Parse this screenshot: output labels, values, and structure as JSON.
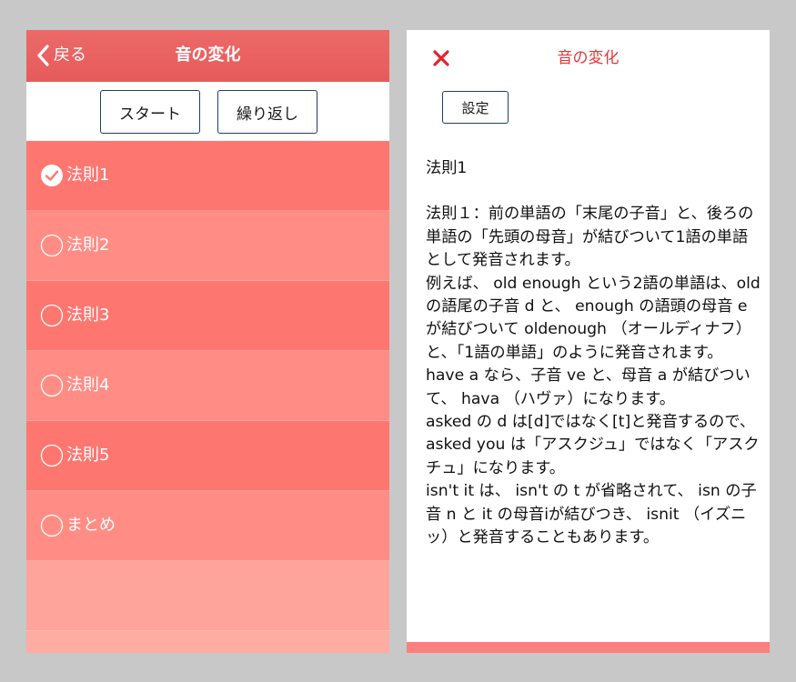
{
  "left": {
    "nav": {
      "back_label": "戻る",
      "title": "音の変化"
    },
    "toolbar": {
      "start_label": "スタート",
      "repeat_label": "繰り返し"
    },
    "items": [
      {
        "label": "法則1",
        "checked": true
      },
      {
        "label": "法則2",
        "checked": false
      },
      {
        "label": "法則3",
        "checked": false
      },
      {
        "label": "法則4",
        "checked": false
      },
      {
        "label": "法則5",
        "checked": false
      },
      {
        "label": "まとめ",
        "checked": false
      }
    ]
  },
  "right": {
    "title": "音の変化",
    "settings_label": "設定",
    "heading": "法則1",
    "body": "法則１：前の単語の「末尾の子音」と、後ろの単語の「先頭の母音」が結びついて1語の単語として発音されます。\n例えば、 old enough という2語の単語は、old の語尾の子音 d と、 enough の語頭の母音 e が結びついて oldenough （オールディナフ）と、「1語の単語」のように発音されます。\nhave a なら、子音 ve と、母音 a が結びついて、 hava （ハヴァ）になります。\nasked の d は[d]ではなく[t]と発音するので、 asked you は「アスクジュ」ではなく「アスクチュ」になります。\nisn't it は、 isn't の t が省略されて、 isn の子音 n と it の母音iが結びつき、 isnit （イズニッ）と発音することもあります。"
  },
  "colors": {
    "nav_red": "#e65b5b",
    "row_dark": "#fd7770",
    "row_light": "#ff8d85",
    "accent_red": "#e33838",
    "button_border": "#1f3e66"
  },
  "icons": {
    "back": "chevron-left-icon",
    "checked": "check-circle-icon",
    "unchecked": "empty-circle-icon",
    "close": "close-icon"
  }
}
